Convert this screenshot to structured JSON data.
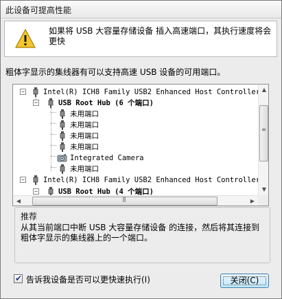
{
  "window": {
    "title": "此设备可提高性能"
  },
  "banner": {
    "icon": "warning-icon",
    "text": "如果将 USB 大容量存储设备 插入高速端口，其执行速度将会\n更快"
  },
  "description": "粗体字显示的集线器有可以支持高速 USB 设备的可用端口。",
  "tree": {
    "rows": [
      {
        "label": "Intel(R) ICH8 Family USB2 Enhanced Host Controller -",
        "bold": false,
        "icon": "usb-controller-icon"
      },
      {
        "label": "USB Root Hub (6 个端口)",
        "bold": true,
        "icon": "usb-hub-icon"
      },
      {
        "label": "未用端口",
        "bold": false,
        "icon": "usb-port-icon"
      },
      {
        "label": "未用端口",
        "bold": false,
        "icon": "usb-port-icon"
      },
      {
        "label": "未用端口",
        "bold": false,
        "icon": "usb-port-icon"
      },
      {
        "label": "未用端口",
        "bold": false,
        "icon": "usb-port-icon"
      },
      {
        "label": "Integrated Camera",
        "bold": false,
        "icon": "camera-icon"
      },
      {
        "label": "未用端口",
        "bold": false,
        "icon": "usb-port-icon"
      },
      {
        "label": "Intel(R) ICH8 Family USB2 Enhanced Host Controller -",
        "bold": false,
        "icon": "usb-controller-icon"
      },
      {
        "label": "USB Root Hub (4 个端口)",
        "bold": true,
        "icon": "usb-hub-icon"
      }
    ]
  },
  "hint": {
    "label": "推荐",
    "text": "从其当前端口中断 USB 大容量存储设备 的连接，然后将其连接到粗体字显示的集线器上的一个端口。"
  },
  "checkbox": {
    "label": "告诉我设备是否可以更快速执行(I)",
    "checked": true
  },
  "buttons": {
    "close": "关闭(C)"
  }
}
